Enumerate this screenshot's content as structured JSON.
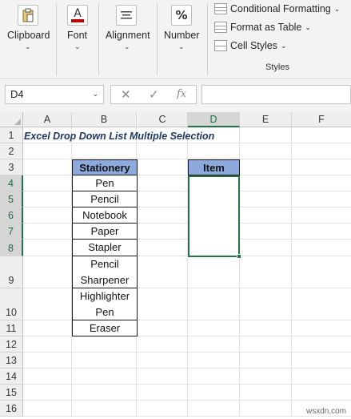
{
  "ribbon": {
    "groups": [
      {
        "label": "Clipboard",
        "icon": "clipboard-icon"
      },
      {
        "label": "Font",
        "icon": "font-color-icon"
      },
      {
        "label": "Alignment",
        "icon": "align-icon"
      },
      {
        "label": "Number",
        "icon": "percent-icon"
      }
    ],
    "styles": {
      "conditional_formatting": "Conditional Formatting",
      "format_as_table": "Format as Table",
      "cell_styles": "Cell Styles",
      "group_label": "Styles"
    },
    "icon_font_letter": "A",
    "icon_percent": "%"
  },
  "formula_bar": {
    "name_box": "D4",
    "cancel_glyph": "✕",
    "enter_glyph": "✓",
    "fx_glyph": "fx",
    "formula": ""
  },
  "sheet": {
    "columns": [
      "A",
      "B",
      "C",
      "D",
      "E",
      "F"
    ],
    "rows": [
      "1",
      "2",
      "3",
      "4",
      "5",
      "6",
      "7",
      "8",
      "9",
      "10",
      "11",
      "12",
      "13",
      "14",
      "15",
      "16"
    ],
    "selected_column": "D",
    "title": "Excel Drop Down List Multiple Selection",
    "stationery_header": "Stationery",
    "stationery_items": [
      "Pen",
      "Pencil",
      "Notebook",
      "Paper",
      "Stapler",
      "Pencil Sharpener",
      "Highlighter Pen",
      "Eraser"
    ],
    "item_header": "Item"
  },
  "watermark": "wsxdn.com",
  "colors": {
    "header_fill": "#8ea9db",
    "selection": "#217346",
    "title": "#1f3864"
  }
}
